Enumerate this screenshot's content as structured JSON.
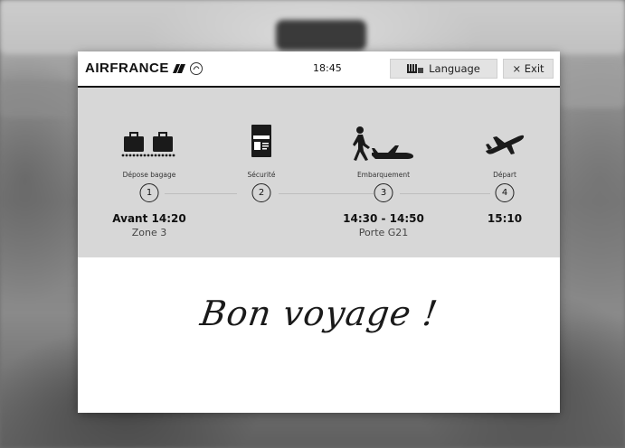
{
  "header": {
    "brand": "AIRFRANCE",
    "time": "18:45",
    "language_label": "Language",
    "exit_label": "× Exit"
  },
  "steps": [
    {
      "label": "Dépose bagage",
      "number": "1",
      "time": "Avant 14:20",
      "place": "Zone 3",
      "icon": "baggage-icon"
    },
    {
      "label": "Sécurité",
      "number": "2",
      "time": "",
      "place": "",
      "icon": "passport-icon"
    },
    {
      "label": "Embarquement",
      "number": "3",
      "time": "14:30 - 14:50",
      "place": "Porte G21",
      "icon": "boarding-icon"
    },
    {
      "label": "Départ",
      "number": "4",
      "time": "15:10",
      "place": "",
      "icon": "departure-plane-icon"
    }
  ],
  "message": "Bon voyage !"
}
